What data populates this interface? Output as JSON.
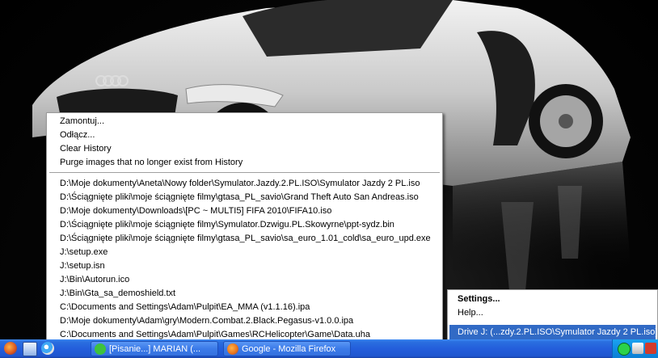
{
  "context_menu": {
    "top_items": [
      "Zamontuj...",
      "Odłącz...",
      "Clear History",
      "Purge images that no longer exist from History"
    ],
    "history": [
      "D:\\Moje dokumenty\\Aneta\\Nowy folder\\Symulator.Jazdy.2.PL.ISO\\Symulator Jazdy 2 PL.iso",
      "D:\\Ściągnięte pliki\\moje ściągnięte filmy\\gtasa_PL_savio\\Grand Theft Auto San Andreas.iso",
      "D:\\Moje dokumenty\\Downloads\\[PC ~ MULTI5] FIFA 2010\\FIFA10.iso",
      "D:\\Ściągnięte pliki\\moje ściągnięte filmy\\Symulator.Dzwigu.PL.Skowyrne\\ppt-sydz.bin",
      "D:\\Ściągnięte pliki\\moje ściągnięte filmy\\gtasa_PL_savio\\sa_euro_1.01_cold\\sa_euro_upd.exe",
      "J:\\setup.exe",
      "J:\\setup.isn",
      "J:\\Bin\\Autorun.ico",
      "J:\\Bin\\Gta_sa_demoshield.txt",
      "C:\\Documents and Settings\\Adam\\Pulpit\\EA_MMA (v1.1.16).ipa",
      "D:\\Moje dokumenty\\Adam\\gry\\Modern.Combat.2.Black.Pegasus-v1.0.0.ipa",
      "C:\\Documents and Settings\\Adam\\Pulpit\\Games\\RCHelicopter\\Game\\Data.uha"
    ]
  },
  "tray_menu": {
    "settings": "Settings...",
    "help": "Help...",
    "drive": "Drive J: (...zdy.2.PL.ISO\\Symulator Jazdy 2 PL.iso)"
  },
  "taskbar": {
    "buttons": [
      {
        "label": "[Pisanie...] MARIAN (...",
        "icon": "messenger-icon",
        "color": "#3ec23e"
      },
      {
        "label": "Google - Mozilla Firefox",
        "icon": "firefox-icon",
        "color": "#e8701a"
      }
    ]
  },
  "colors": {
    "highlight": "#316ac5",
    "taskbar": "#245edb",
    "tray": "#0f8ee4"
  }
}
